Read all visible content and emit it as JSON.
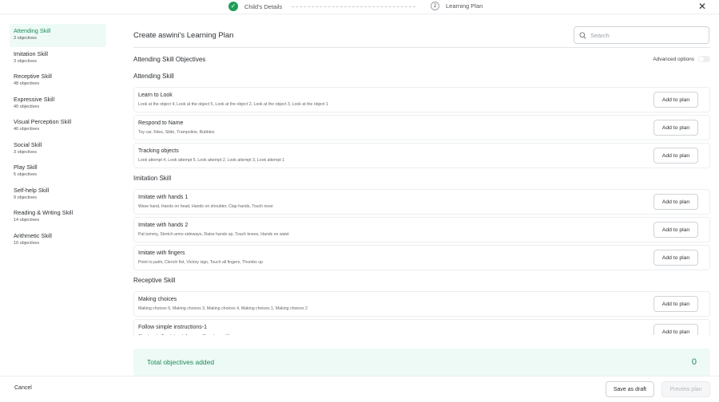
{
  "stepper": {
    "step1_label": "Child's Details",
    "step2_number": "2",
    "step2_label": "Learning Plan"
  },
  "sidebar": {
    "items": [
      {
        "label": "Attending Skill",
        "count": "3 objectives",
        "active": true
      },
      {
        "label": "Imitation Skill",
        "count": "3 objectives"
      },
      {
        "label": "Receptive Skill",
        "count": "48 objectives"
      },
      {
        "label": "Expressive Skill",
        "count": "40 objectives"
      },
      {
        "label": "Visual Perception Skill",
        "count": "40 objectives"
      },
      {
        "label": "Social Skill",
        "count": "3 objectives"
      },
      {
        "label": "Play Skill",
        "count": "5 objectives"
      },
      {
        "label": "Self-help Skill",
        "count": "9 objectives"
      },
      {
        "label": "Reading & Writing Skill",
        "count": "14 objectives"
      },
      {
        "label": "Arithmetic Skill",
        "count": "10 objectives"
      }
    ]
  },
  "main": {
    "title": "Create aswini's Learning Plan",
    "search_placeholder": "Search",
    "objectives_heading": "Attending Skill Objectives",
    "advanced_label": "Advanced options",
    "add_label": "Add to plan",
    "sections": [
      {
        "title": "Attending Skill",
        "objectives": [
          {
            "name": "Learn to Look",
            "desc": "Look at the object 4, Look at the object 5, Look at the object 2, Look at the object 3, Look at the object 1"
          },
          {
            "name": "Respond to Name",
            "desc": "Toy car, Kites, Slide, Trampoline, Bubbles"
          },
          {
            "name": "Tracking objects",
            "desc": "Look attempt 4, Look attempt 5, Look attempt 2, Look attempt 3, Look attempt 1"
          }
        ]
      },
      {
        "title": "Imitation Skill",
        "objectives": [
          {
            "name": "Imitate with hands 1",
            "desc": "Wave hand, Hands on head, Hands on shoulder, Clap hands, Touch nose"
          },
          {
            "name": "Imitate with hands 2",
            "desc": "Pat tummy, Stretch arms sideways, Raise hands up, Touch knees, Hands on waist"
          },
          {
            "name": "Imitate with fingers",
            "desc": "Point to palm, Clench fist, Victory sign, Touch all fingers, Thumbs up"
          }
        ]
      },
      {
        "title": "Receptive Skill",
        "objectives": [
          {
            "name": "Making choices",
            "desc": "Making choices 5, Making choices 3, Making choices 4, Making choices 1, Making choices 2"
          },
          {
            "name": "Follow simple instructions-1",
            "desc": "Clap hands, Touch head, Arms up, Thumbs up, Wave"
          }
        ]
      }
    ],
    "total_label": "Total objectives added",
    "total_count": "0"
  },
  "footer": {
    "cancel_label": "Cancel",
    "draft_label": "Save as draft",
    "preview_label": "Preview plan"
  },
  "colors": {
    "accent": "#1c8a5a",
    "success": "#1f9d55",
    "active_bg": "#eefaf6"
  }
}
